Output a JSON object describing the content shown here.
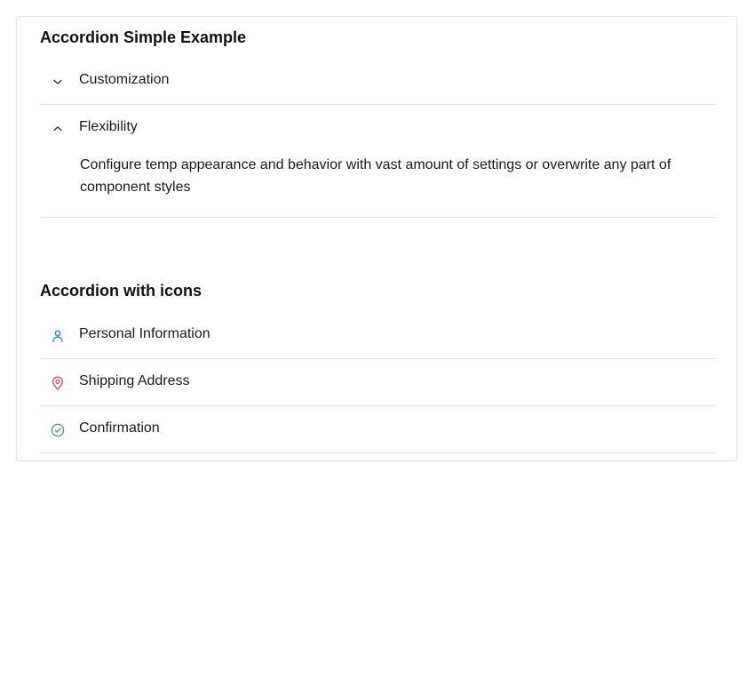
{
  "simple": {
    "title": "Accordion Simple Example",
    "items": [
      {
        "label": "Customization",
        "expanded": false,
        "icon": "chevron-down-icon"
      },
      {
        "label": "Flexibility",
        "expanded": true,
        "icon": "chevron-up-icon",
        "content": "Configure temp appearance and behavior with vast amount of settings or overwrite any part of component styles"
      }
    ]
  },
  "icons": {
    "title": "Accordion with icons",
    "items": [
      {
        "label": "Personal Information",
        "icon": "user-icon",
        "color": "#2f86eb"
      },
      {
        "label": "Shipping Address",
        "icon": "map-pin-icon",
        "color": "#e5484d"
      },
      {
        "label": "Confirmation",
        "icon": "check-circle-icon",
        "color": "#3ba55c"
      }
    ]
  }
}
